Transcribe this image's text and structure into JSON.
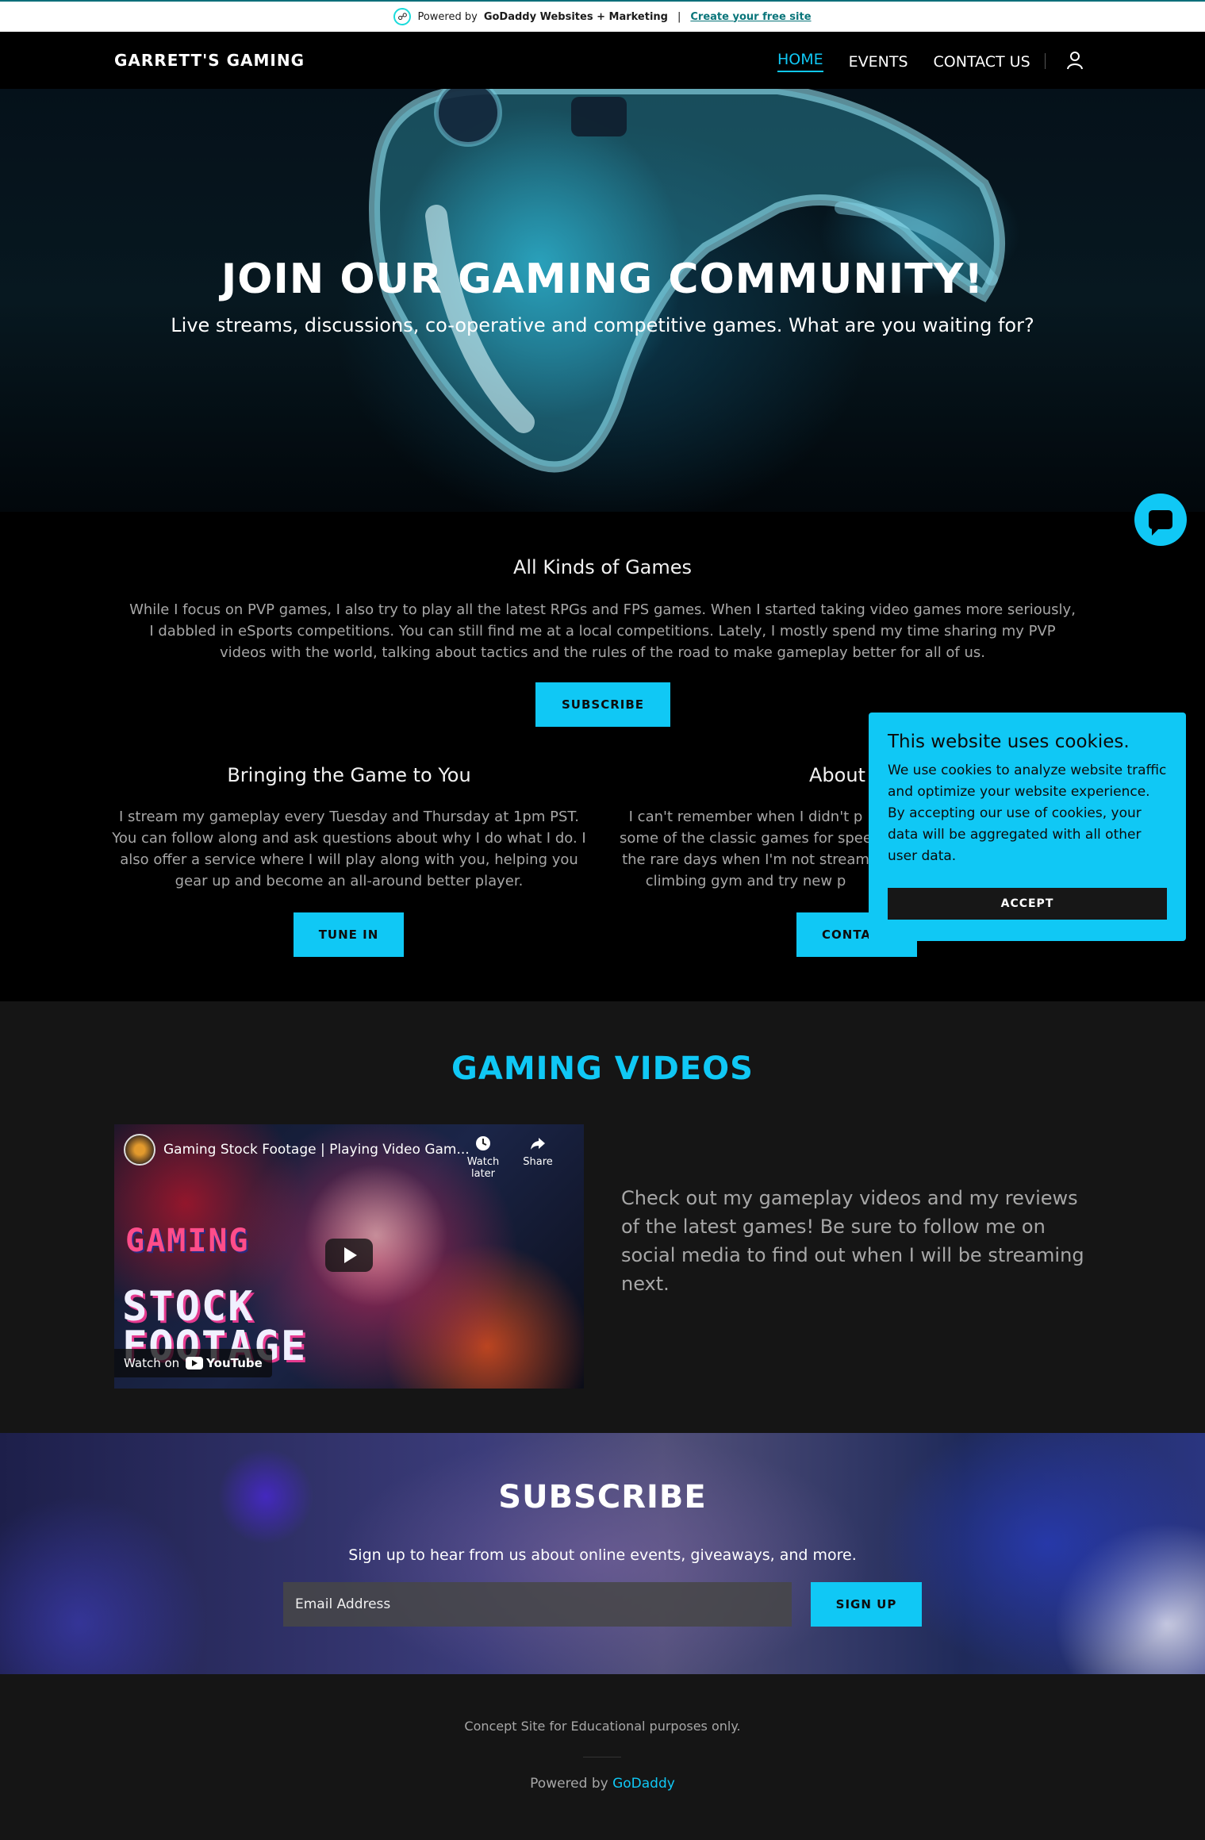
{
  "promo": {
    "prefix": "Powered by",
    "brand": "GoDaddy Websites + Marketing",
    "separator": "|",
    "cta": "Create your free site"
  },
  "nav": {
    "brand": "GARRETT'S GAMING",
    "links": [
      "HOME",
      "EVENTS",
      "CONTACT US"
    ],
    "active": "HOME",
    "user_icon": "user-icon"
  },
  "hero": {
    "title": "JOIN OUR GAMING COMMUNITY!",
    "subtitle": "Live streams, discussions, co-operative and competitive games. What are you waiting for?"
  },
  "about": {
    "heading": "All Kinds of Games",
    "text": "While I focus on PVP games, I also try to play all the latest RPGs and FPS games. When I started taking video games more seriously, I dabbled in eSports competitions. You can still find me at a local competitions. Lately, I mostly spend my time sharing my PVP videos with the world, talking about tactics and the rules of the road to make gameplay better for all of us.",
    "button": "SUBSCRIBE",
    "col1": {
      "heading": "Bringing the Game to You",
      "text": "I stream my gameplay every Tuesday and Thursday at 1pm PST. You can follow along and ask questions about why I do what I do. I also offer a service where I will play along with you, helping you gear up and become an all-around better player.",
      "button": "TUNE IN"
    },
    "col2": {
      "heading": "About",
      "text": "I can't remember when I didn't p some of the classic games for spee the rare days when I'm not stream climbing gym and try new p",
      "button": "CONTA"
    }
  },
  "cookie": {
    "title": "This website uses cookies.",
    "text": "We use cookies to analyze website traffic and optimize your website experience. By accepting our use of cookies, your data will be aggregated with all other user data.",
    "accept": "ACCEPT"
  },
  "videos": {
    "heading": "GAMING VIDEOS",
    "yt_title": "Gaming Stock Footage | Playing Video Gam...",
    "watch_later": "Watch later",
    "share": "Share",
    "thumb_word1": "GAMING",
    "thumb_word2": "STOCK",
    "thumb_word3": "FOOTAGE",
    "watch_on": "Watch on",
    "youtube": "YouTube",
    "text": "Check out my gameplay videos and my reviews of the latest games! Be sure to follow me on social media to find out when I will be streaming next."
  },
  "subscribe": {
    "heading": "SUBSCRIBE",
    "text": "Sign up to hear from us about online events, giveaways, and more.",
    "email_placeholder": "Email Address",
    "button": "SIGN UP"
  },
  "footer": {
    "note": "Concept Site for Educational purposes only.",
    "powered_prefix": "Powered by",
    "powered_link": "GoDaddy"
  },
  "colors": {
    "accent": "#10c8f5",
    "dark_bg": "#000000",
    "section_bg": "#151515"
  }
}
